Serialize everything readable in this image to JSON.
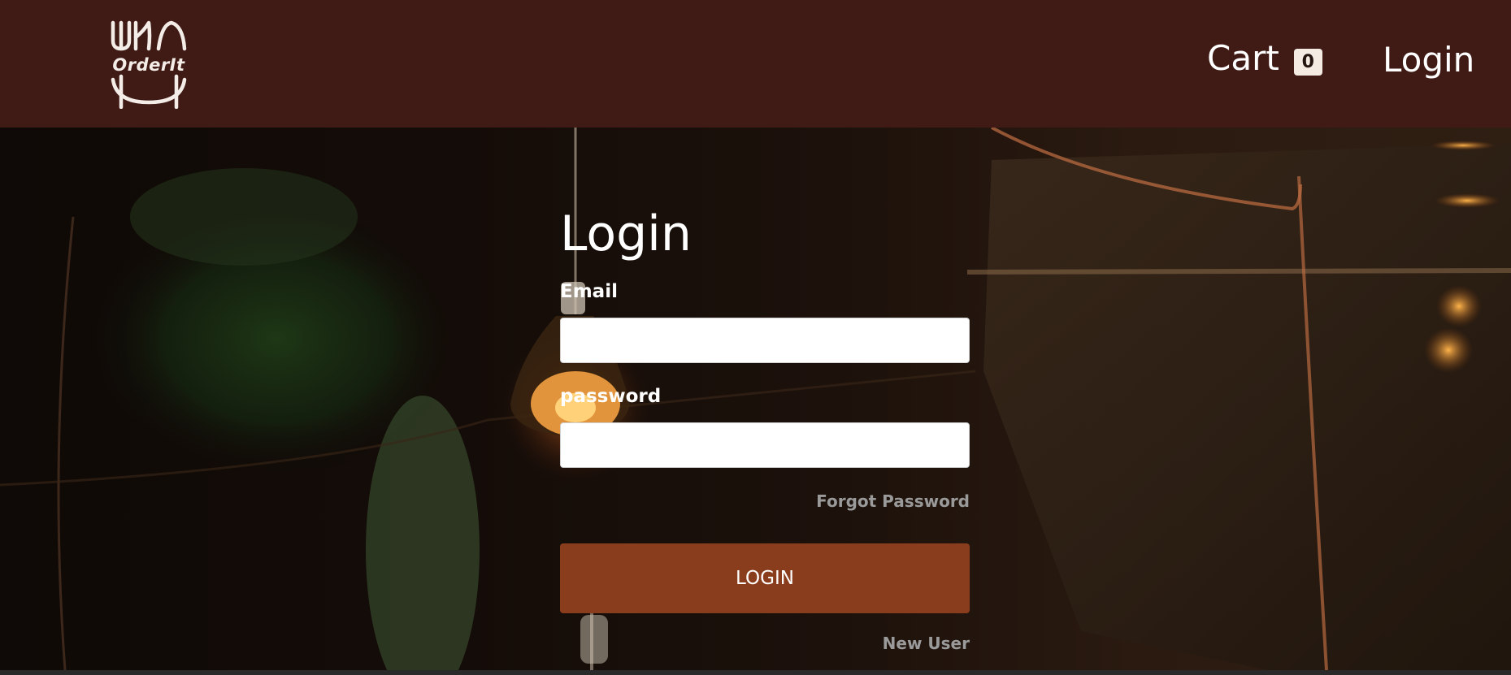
{
  "brand": {
    "name": "OrderIt",
    "logo_icon": "fork-knife-plate-icon"
  },
  "nav": {
    "cart_label": "Cart",
    "cart_count": "0",
    "login_label": "Login"
  },
  "login_form": {
    "title": "Login",
    "email_label": "Email",
    "email_value": "",
    "password_label": "password",
    "password_value": "",
    "forgot_password": "Forgot Password",
    "submit_label": "LOGIN",
    "new_user": "New User"
  },
  "colors": {
    "header_bg": "#401b16",
    "button_bg": "#8a3d1d",
    "link_gray": "#9a9a9a",
    "badge_bg": "#f4ece3"
  }
}
